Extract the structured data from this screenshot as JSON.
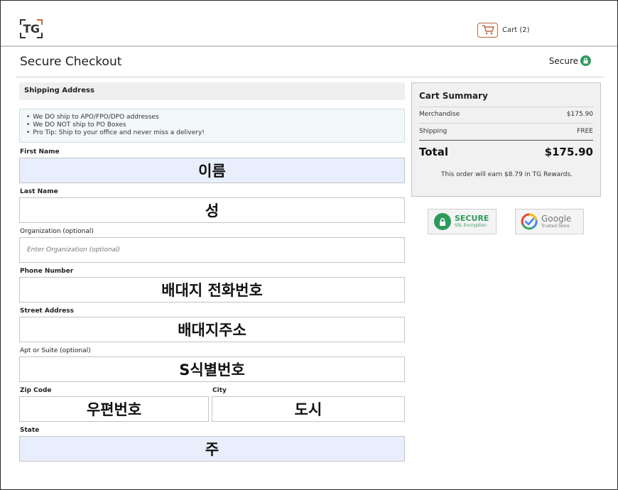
{
  "header": {
    "logo_text": "TG",
    "cart_label": "Cart (2)"
  },
  "page": {
    "title": "Secure Checkout",
    "secure_label": "Secure"
  },
  "shipping": {
    "section_title": "Shipping Address",
    "notices": [
      "We DO ship to APO/FPO/DPO addresses",
      "We DO NOT ship to PO Boxes",
      "Pro Tip: Ship to your office and never miss a delivery!"
    ],
    "fields": {
      "first_name": {
        "label": "First Name",
        "value": "이름"
      },
      "last_name": {
        "label": "Last Name",
        "value": "성"
      },
      "organization": {
        "label": "Organization (optional)",
        "placeholder": "Enter Organization (optional)"
      },
      "phone": {
        "label": "Phone Number",
        "value": "배대지 전화번호"
      },
      "street": {
        "label": "Street Address",
        "value": "배대지주소"
      },
      "apt": {
        "label": "Apt or Suite (optional)",
        "value": "S식별번호"
      },
      "zip": {
        "label": "Zip Code",
        "value": "우편번호"
      },
      "city": {
        "label": "City",
        "value": "도시"
      },
      "state": {
        "label": "State",
        "value": "주"
      }
    }
  },
  "summary": {
    "title": "Cart Summary",
    "merchandise_label": "Merchandise",
    "merchandise_value": "$175.90",
    "shipping_label": "Shipping",
    "shipping_value": "FREE",
    "total_label": "Total",
    "total_value": "$175.90",
    "rewards_note": "This order will earn $8.79 in TG Rewards."
  },
  "badges": {
    "ssl_main": "SECURE",
    "ssl_sub": "SSL Encryption",
    "google_main": "Google",
    "google_sub": "Trusted Store"
  },
  "colors": {
    "accent_green": "#2e9a5a",
    "cart_orange": "#b5673c",
    "field_tint": "#e8eefb"
  }
}
